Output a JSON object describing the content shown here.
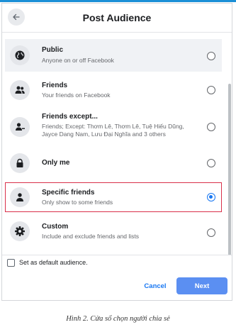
{
  "dialog": {
    "title": "Post Audience",
    "back_icon": "arrow-left-icon"
  },
  "options": [
    {
      "label": "Public",
      "description": "Anyone on or off Facebook",
      "icon": "globe-icon",
      "selected": false
    },
    {
      "label": "Friends",
      "description": "Your friends on Facebook",
      "icon": "friends-icon",
      "selected": false
    },
    {
      "label": "Friends except...",
      "description": "Friends; Except: Thơm Lê, Thơm Lê, Tuệ Hiếu Dũng, Jayce Dang Nam, Lưu Đại Nghĩa and 3 others",
      "icon": "friend-except-icon",
      "selected": false
    },
    {
      "label": "Only me",
      "description": "",
      "icon": "lock-icon",
      "selected": false
    },
    {
      "label": "Specific friends",
      "description": "Only show to some friends",
      "icon": "person-icon",
      "selected": true
    },
    {
      "label": "Custom",
      "description": "Include and exclude friends and lists",
      "icon": "gear-icon",
      "selected": false
    }
  ],
  "footer": {
    "default_label": "Set as default audience.",
    "default_checked": false,
    "cancel_label": "Cancel",
    "next_label": "Next"
  },
  "caption": "Hình 2. Cửa sổ chọn người chia sẻ",
  "colors": {
    "accent": "#1877f2",
    "next_button": "#5b8ff2",
    "highlight_border": "#d9304a"
  }
}
